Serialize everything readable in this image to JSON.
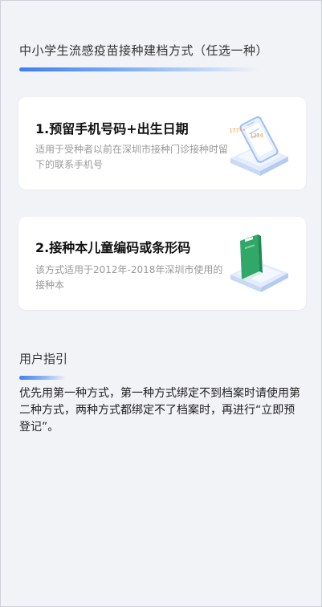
{
  "header": {
    "title": "中小学生流感疫苗接种建档方式（任选一种）"
  },
  "options": [
    {
      "title": "1.预留手机号码+出生日期",
      "description": "适用于受种者以前在深圳市接种门诊接种时留下的联系手机号",
      "illustration": "phone-icon"
    },
    {
      "title": "2.接种本儿童编码或条形码",
      "description": "该方式适用于2012年-2018年深圳市使用的接种本",
      "illustration": "vaccination-booklet-icon"
    }
  ],
  "guide": {
    "title": "用户指引",
    "text": "优先用第一种方式，第一种方式绑定不到档案时请使用第二种方式，两种方式都绑定不了档案时，再进行“立即预登记”。"
  },
  "colors": {
    "background": "#f2f3f7",
    "accent": "#3d7ff0",
    "card": "#ffffff",
    "booklet": "#2fa86a"
  }
}
